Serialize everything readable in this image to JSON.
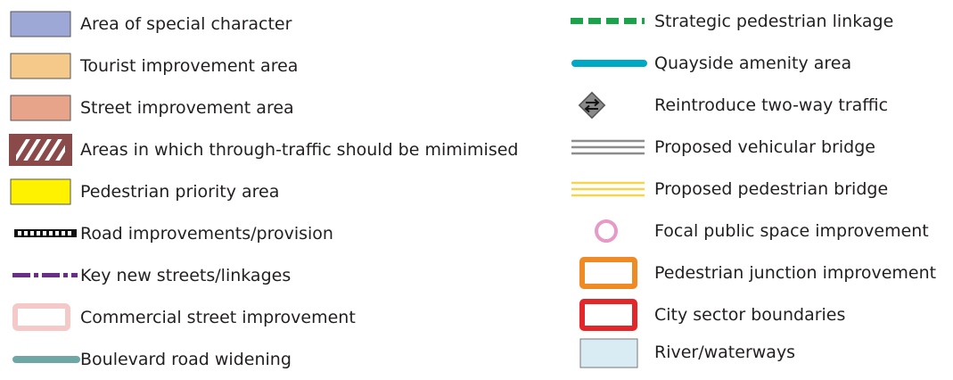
{
  "legend_left": [
    {
      "key": "special_character",
      "label": "Area of special character",
      "symbol": "filled-box",
      "color": "#9ea8d6"
    },
    {
      "key": "tourist",
      "label": "Tourist improvement area",
      "symbol": "filled-box",
      "color": "#f4c98a"
    },
    {
      "key": "street_improvement",
      "label": "Street improvement area",
      "symbol": "filled-box",
      "color": "#e8a48a"
    },
    {
      "key": "through_traffic",
      "label": "Areas in which through-traffic should be mimimised",
      "symbol": "hatched-box",
      "color": "#8b4a4a"
    },
    {
      "key": "pedestrian_priority",
      "label": "Pedestrian priority area",
      "symbol": "filled-box",
      "color": "#fff200"
    },
    {
      "key": "road_improvements",
      "label": "Road improvements/provision",
      "symbol": "ladder-line",
      "color": "#111111"
    },
    {
      "key": "key_streets",
      "label": "Key new streets/linkages",
      "symbol": "dashed-line",
      "color": "#6a2d8a"
    },
    {
      "key": "commercial",
      "label": "Commercial street improvement",
      "symbol": "outline-box",
      "color": "#f6c9c9"
    },
    {
      "key": "boulevard",
      "label": "Boulevard road widening",
      "symbol": "thick-line",
      "color": "#6fa6a6"
    }
  ],
  "legend_right": [
    {
      "key": "strategic_ped",
      "label": "Strategic pedestrian linkage",
      "symbol": "green-dashes",
      "color": "#1aa34a"
    },
    {
      "key": "quayside",
      "label": "Quayside amenity area",
      "symbol": "thick-line",
      "color": "#00a8c6"
    },
    {
      "key": "two_way",
      "label": "Reintroduce two-way traffic",
      "symbol": "diamond-arrows",
      "color": "#8a8a8a"
    },
    {
      "key": "vehicular_bridge",
      "label": "Proposed vehicular bridge",
      "symbol": "triple-lines",
      "color": "#8d8d8d"
    },
    {
      "key": "pedestrian_bridge",
      "label": "Proposed pedestrian bridge",
      "symbol": "triple-lines",
      "color": "#f5d54a"
    },
    {
      "key": "focal_space",
      "label": "Focal public space improvement",
      "symbol": "ring",
      "color": "#e79ac8"
    },
    {
      "key": "ped_junction",
      "label": "Pedestrian junction improvement",
      "symbol": "outline-box",
      "color": "#f08a24"
    },
    {
      "key": "city_sector",
      "label": "City sector boundaries",
      "symbol": "outline-box",
      "color": "#e3262a"
    },
    {
      "key": "river",
      "label": "River/waterways",
      "symbol": "filled-box",
      "color": "#d9ecf4"
    }
  ]
}
